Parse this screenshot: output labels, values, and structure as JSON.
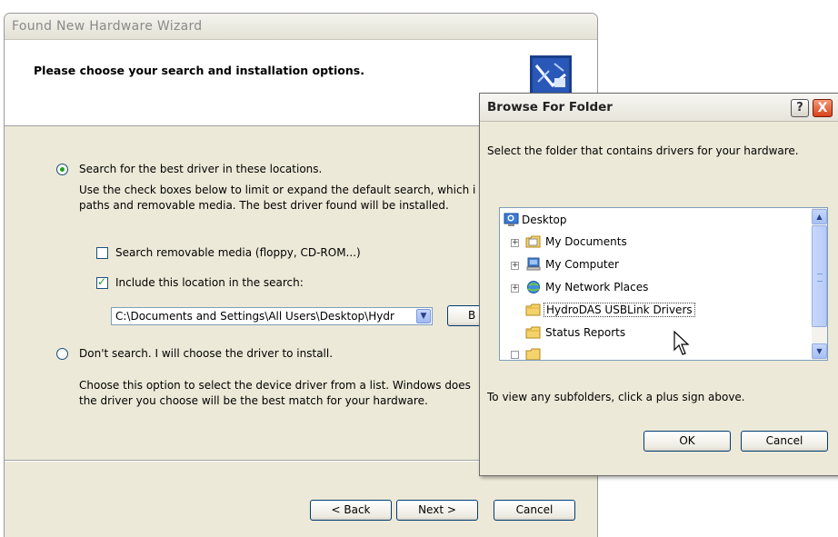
{
  "wizard": {
    "title": "Found New Hardware Wizard",
    "header_title": "Please choose your search and installation options.",
    "option_search_label": "Search for the best driver in these locations.",
    "option_search_desc_line1": "Use the check boxes below to limit or expand the default search, which i",
    "option_search_desc_line2": "paths and removable media. The best driver found will be installed.",
    "check_removable_label": "Search removable media (floppy, CD-ROM...)",
    "check_removable_checked": false,
    "check_include_label": "Include this location in the search:",
    "check_include_checked": true,
    "path_value": "C:\\Documents and Settings\\All Users\\Desktop\\Hydr",
    "browse_button_partial": "B",
    "option_dontsearch_label": "Don't search. I will choose the driver to install.",
    "option_dontsearch_desc_line1": "Choose this option to select the device driver from a list.  Windows does",
    "option_dontsearch_desc_line2": "the driver you choose will be the best match for your hardware.",
    "selected_option": "search",
    "buttons": {
      "back": "< Back",
      "next": "Next >",
      "cancel": "Cancel"
    }
  },
  "browse_dialog": {
    "title": "Browse For Folder",
    "instruction": "Select the folder that contains drivers for your hardware.",
    "tree": [
      {
        "label": "Desktop",
        "icon": "desktop-icon",
        "expander": ""
      },
      {
        "label": "My Documents",
        "icon": "folder-documents-icon",
        "expander": "+"
      },
      {
        "label": "My Computer",
        "icon": "computer-icon",
        "expander": "+"
      },
      {
        "label": "My Network Places",
        "icon": "network-icon",
        "expander": "+"
      },
      {
        "label": "HydroDAS USBLink Drivers",
        "icon": "folder-icon",
        "expander": "",
        "selected": true
      },
      {
        "label": "Status Reports",
        "icon": "folder-icon",
        "expander": ""
      }
    ],
    "hint": "To view any subfolders, click a plus sign above.",
    "ok_label": "OK",
    "cancel_label": "Cancel",
    "help_label": "?",
    "close_label": "X"
  },
  "colors": {
    "dialog_face": "#ece9d8",
    "xp_button_border": "#003c74",
    "close_red": "#d9421b",
    "check_green": "#21a121"
  }
}
